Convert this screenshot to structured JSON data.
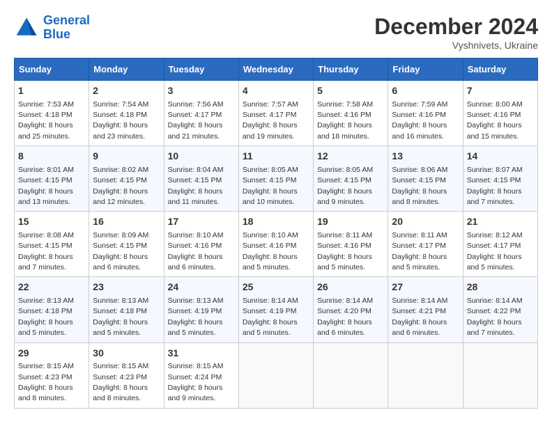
{
  "header": {
    "logo_line1": "General",
    "logo_line2": "Blue",
    "month_year": "December 2024",
    "location": "Vyshnivets, Ukraine"
  },
  "weekdays": [
    "Sunday",
    "Monday",
    "Tuesday",
    "Wednesday",
    "Thursday",
    "Friday",
    "Saturday"
  ],
  "weeks": [
    [
      {
        "day": "1",
        "sunrise": "7:53 AM",
        "sunset": "4:18 PM",
        "daylight": "8 hours and 25 minutes."
      },
      {
        "day": "2",
        "sunrise": "7:54 AM",
        "sunset": "4:18 PM",
        "daylight": "8 hours and 23 minutes."
      },
      {
        "day": "3",
        "sunrise": "7:56 AM",
        "sunset": "4:17 PM",
        "daylight": "8 hours and 21 minutes."
      },
      {
        "day": "4",
        "sunrise": "7:57 AM",
        "sunset": "4:17 PM",
        "daylight": "8 hours and 19 minutes."
      },
      {
        "day": "5",
        "sunrise": "7:58 AM",
        "sunset": "4:16 PM",
        "daylight": "8 hours and 18 minutes."
      },
      {
        "day": "6",
        "sunrise": "7:59 AM",
        "sunset": "4:16 PM",
        "daylight": "8 hours and 16 minutes."
      },
      {
        "day": "7",
        "sunrise": "8:00 AM",
        "sunset": "4:16 PM",
        "daylight": "8 hours and 15 minutes."
      }
    ],
    [
      {
        "day": "8",
        "sunrise": "8:01 AM",
        "sunset": "4:15 PM",
        "daylight": "8 hours and 13 minutes."
      },
      {
        "day": "9",
        "sunrise": "8:02 AM",
        "sunset": "4:15 PM",
        "daylight": "8 hours and 12 minutes."
      },
      {
        "day": "10",
        "sunrise": "8:04 AM",
        "sunset": "4:15 PM",
        "daylight": "8 hours and 11 minutes."
      },
      {
        "day": "11",
        "sunrise": "8:05 AM",
        "sunset": "4:15 PM",
        "daylight": "8 hours and 10 minutes."
      },
      {
        "day": "12",
        "sunrise": "8:05 AM",
        "sunset": "4:15 PM",
        "daylight": "8 hours and 9 minutes."
      },
      {
        "day": "13",
        "sunrise": "8:06 AM",
        "sunset": "4:15 PM",
        "daylight": "8 hours and 8 minutes."
      },
      {
        "day": "14",
        "sunrise": "8:07 AM",
        "sunset": "4:15 PM",
        "daylight": "8 hours and 7 minutes."
      }
    ],
    [
      {
        "day": "15",
        "sunrise": "8:08 AM",
        "sunset": "4:15 PM",
        "daylight": "8 hours and 7 minutes."
      },
      {
        "day": "16",
        "sunrise": "8:09 AM",
        "sunset": "4:15 PM",
        "daylight": "8 hours and 6 minutes."
      },
      {
        "day": "17",
        "sunrise": "8:10 AM",
        "sunset": "4:16 PM",
        "daylight": "8 hours and 6 minutes."
      },
      {
        "day": "18",
        "sunrise": "8:10 AM",
        "sunset": "4:16 PM",
        "daylight": "8 hours and 5 minutes."
      },
      {
        "day": "19",
        "sunrise": "8:11 AM",
        "sunset": "4:16 PM",
        "daylight": "8 hours and 5 minutes."
      },
      {
        "day": "20",
        "sunrise": "8:11 AM",
        "sunset": "4:17 PM",
        "daylight": "8 hours and 5 minutes."
      },
      {
        "day": "21",
        "sunrise": "8:12 AM",
        "sunset": "4:17 PM",
        "daylight": "8 hours and 5 minutes."
      }
    ],
    [
      {
        "day": "22",
        "sunrise": "8:13 AM",
        "sunset": "4:18 PM",
        "daylight": "8 hours and 5 minutes."
      },
      {
        "day": "23",
        "sunrise": "8:13 AM",
        "sunset": "4:18 PM",
        "daylight": "8 hours and 5 minutes."
      },
      {
        "day": "24",
        "sunrise": "8:13 AM",
        "sunset": "4:19 PM",
        "daylight": "8 hours and 5 minutes."
      },
      {
        "day": "25",
        "sunrise": "8:14 AM",
        "sunset": "4:19 PM",
        "daylight": "8 hours and 5 minutes."
      },
      {
        "day": "26",
        "sunrise": "8:14 AM",
        "sunset": "4:20 PM",
        "daylight": "8 hours and 6 minutes."
      },
      {
        "day": "27",
        "sunrise": "8:14 AM",
        "sunset": "4:21 PM",
        "daylight": "8 hours and 6 minutes."
      },
      {
        "day": "28",
        "sunrise": "8:14 AM",
        "sunset": "4:22 PM",
        "daylight": "8 hours and 7 minutes."
      }
    ],
    [
      {
        "day": "29",
        "sunrise": "8:15 AM",
        "sunset": "4:23 PM",
        "daylight": "8 hours and 8 minutes."
      },
      {
        "day": "30",
        "sunrise": "8:15 AM",
        "sunset": "4:23 PM",
        "daylight": "8 hours and 8 minutes."
      },
      {
        "day": "31",
        "sunrise": "8:15 AM",
        "sunset": "4:24 PM",
        "daylight": "8 hours and 9 minutes."
      },
      null,
      null,
      null,
      null
    ]
  ]
}
